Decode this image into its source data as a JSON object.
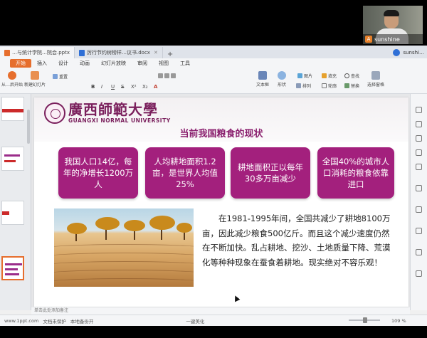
{
  "tabs": [
    {
      "label": "…与统计学院…院会.pptx",
      "color": "#e66e2d"
    },
    {
      "label": "厉行节约树榜样…议书.docx",
      "color": "#2f6fd6"
    }
  ],
  "user": "sunshi…",
  "webcam": {
    "name": "sunshine"
  },
  "menu": [
    "开始",
    "插入",
    "设计",
    "动画",
    "幻灯片放映",
    "审阅",
    "视图",
    "工具"
  ],
  "ribbon": {
    "from_start": "从…后开始",
    "new_slide": "新建幻灯片",
    "reset": "重置",
    "format_buttons": [
      "B",
      "I",
      "U",
      "S",
      "X²",
      "X₂",
      "A"
    ],
    "textbox": "文本框",
    "shape": "形状",
    "arrange": "排列",
    "image": "图片",
    "fill": "填充",
    "outline": "轮廓",
    "find": "查找",
    "replace": "替换",
    "select": "选择窗格"
  },
  "slide": {
    "school_cn": "廣西師範大學",
    "school_en": "GUANGXI NORMAL UNIVERSITY",
    "title": "当前我国粮食的现状",
    "cards": [
      "我国人口14亿，每年的净增长1200万人",
      "人均耕地面积1.2亩，是世界人均值25%",
      "耕地面积正以每年30多万亩减少",
      "全国40%的城市人口消耗的粮食依靠进口"
    ],
    "paragraph": "在1981-1995年间，全国共减少了耕地8100万亩，因此减少粮食500亿斤。而且这个减少速度仍然在不断加快。乱占耕地、挖沙、土地质量下降、荒漠化等种种现象在蚕食着耕地。现实绝对不容乐观！"
  },
  "notes": "单击此处添加备注",
  "status": {
    "site": "www.1ppt.com",
    "protect": "文档未保护",
    "backup": "本地备份开",
    "beautify": "一键美化",
    "zoom": "109 %"
  },
  "colors": {
    "accent": "#e66e2d",
    "purple": "#a3207d"
  }
}
